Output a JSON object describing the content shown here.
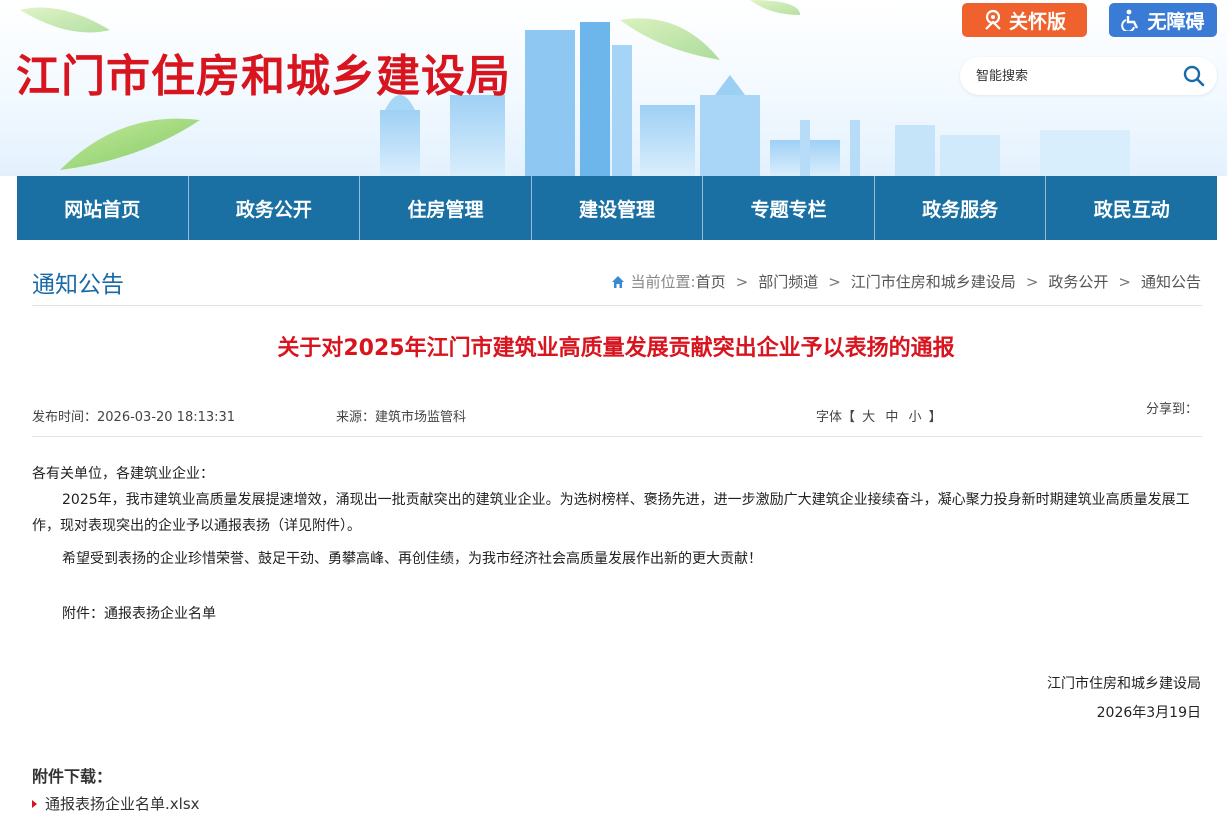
{
  "header": {
    "site_title": "江门市住房和城乡建设局",
    "care_label": "关怀版",
    "access_label": "无障碍",
    "search_placeholder": "智能搜索"
  },
  "nav": {
    "items": [
      "网站首页",
      "政务公开",
      "住房管理",
      "建设管理",
      "专题专栏",
      "政务服务",
      "政民互动"
    ]
  },
  "section": {
    "title": "通知公告",
    "breadcrumb_label": "当前位置:",
    "breadcrumb": [
      "首页",
      "部门频道",
      "江门市住房和城乡建设局",
      "政务公开",
      "通知公告"
    ]
  },
  "article": {
    "title": "关于对2025年江门市建筑业高质量发展贡献突出企业予以表扬的通报",
    "publish_time": "发布时间：2026-03-20 18:13:31",
    "source": "来源：建筑市场监管科",
    "font_label": "字体【",
    "font_large": "大",
    "font_medium": "中",
    "font_small": "小",
    "font_close": "】",
    "share_label": "分享到：",
    "salutation": "各有关单位，各建筑业企业：",
    "paragraph1": "2025年，我市建筑业高质量发展提速增效，涌现出一批贡献突出的建筑业企业。为选树榜样、褒扬先进，进一步激励广大建筑企业接续奋斗，凝心聚力投身新时期建筑业高质量发展工作，现对表现突出的企业予以通报表扬（详见附件）。",
    "paragraph2": "希望受到表扬的企业珍惜荣誉、鼓足干劲、勇攀高峰、再创佳绩，为我市经济社会高质量发展作出新的更大贡献！",
    "attachment_note": "附件：通报表扬企业名单",
    "sign_org": "江门市住房和城乡建设局",
    "sign_date": "2026年3月19日"
  },
  "attachments": {
    "heading": "附件下载：",
    "files": [
      "通报表扬企业名单.xlsx"
    ]
  },
  "colors": {
    "brand_red": "#d8141e",
    "nav_blue": "#1a70a3",
    "care_orange": "#f0622d",
    "access_blue": "#3a7bd5"
  }
}
